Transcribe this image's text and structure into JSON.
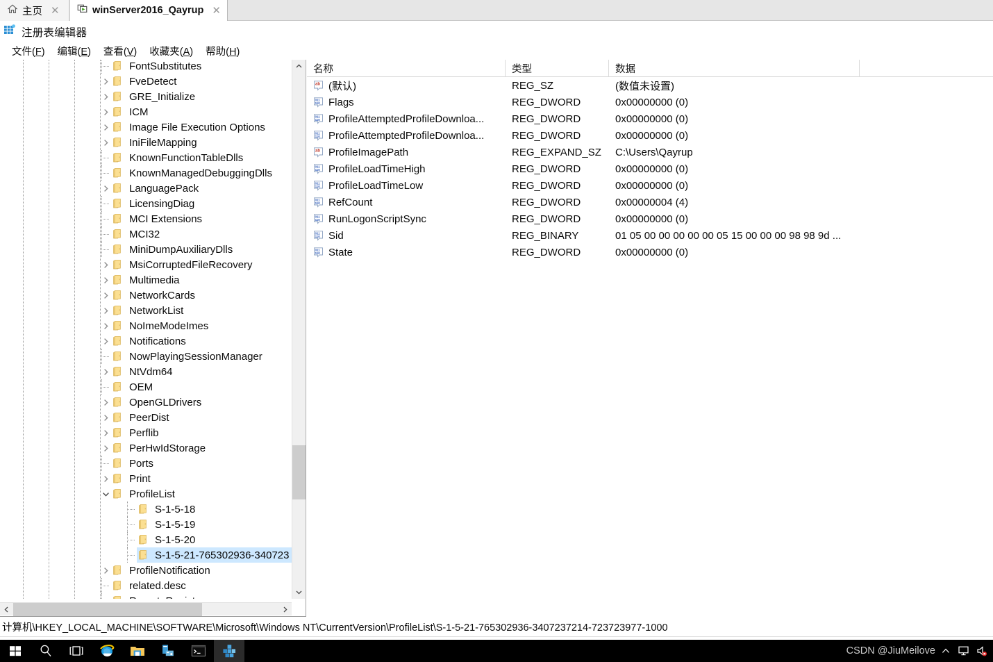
{
  "tabs": [
    {
      "label": "主页",
      "icon": "home-icon",
      "active": false
    },
    {
      "label": "winServer2016_Qayrup",
      "icon": "vm-running-icon",
      "active": true
    }
  ],
  "app": {
    "title": "注册表编辑器",
    "icon": "registry-editor-icon"
  },
  "menubar": [
    {
      "label": "文件(F)",
      "accel": "F"
    },
    {
      "label": "编辑(E)",
      "accel": "E"
    },
    {
      "label": "查看(V)",
      "accel": "V"
    },
    {
      "label": "收藏夹(A)",
      "accel": "A"
    },
    {
      "label": "帮助(H)",
      "accel": "H"
    }
  ],
  "tree": {
    "nodes": [
      {
        "label": "FontSubstitutes",
        "expandable": false,
        "expanded": false,
        "indent": 0,
        "selected": false
      },
      {
        "label": "FveDetect",
        "expandable": true,
        "expanded": false,
        "indent": 0,
        "selected": false
      },
      {
        "label": "GRE_Initialize",
        "expandable": true,
        "expanded": false,
        "indent": 0,
        "selected": false
      },
      {
        "label": "ICM",
        "expandable": true,
        "expanded": false,
        "indent": 0,
        "selected": false
      },
      {
        "label": "Image File Execution Options",
        "expandable": true,
        "expanded": false,
        "indent": 0,
        "selected": false
      },
      {
        "label": "IniFileMapping",
        "expandable": true,
        "expanded": false,
        "indent": 0,
        "selected": false
      },
      {
        "label": "KnownFunctionTableDlls",
        "expandable": false,
        "expanded": false,
        "indent": 0,
        "selected": false
      },
      {
        "label": "KnownManagedDebuggingDlls",
        "expandable": false,
        "expanded": false,
        "indent": 0,
        "selected": false
      },
      {
        "label": "LanguagePack",
        "expandable": true,
        "expanded": false,
        "indent": 0,
        "selected": false
      },
      {
        "label": "LicensingDiag",
        "expandable": false,
        "expanded": false,
        "indent": 0,
        "selected": false
      },
      {
        "label": "MCI Extensions",
        "expandable": false,
        "expanded": false,
        "indent": 0,
        "selected": false
      },
      {
        "label": "MCI32",
        "expandable": false,
        "expanded": false,
        "indent": 0,
        "selected": false
      },
      {
        "label": "MiniDumpAuxiliaryDlls",
        "expandable": false,
        "expanded": false,
        "indent": 0,
        "selected": false
      },
      {
        "label": "MsiCorruptedFileRecovery",
        "expandable": true,
        "expanded": false,
        "indent": 0,
        "selected": false
      },
      {
        "label": "Multimedia",
        "expandable": true,
        "expanded": false,
        "indent": 0,
        "selected": false
      },
      {
        "label": "NetworkCards",
        "expandable": true,
        "expanded": false,
        "indent": 0,
        "selected": false
      },
      {
        "label": "NetworkList",
        "expandable": true,
        "expanded": false,
        "indent": 0,
        "selected": false
      },
      {
        "label": "NoImeModeImes",
        "expandable": true,
        "expanded": false,
        "indent": 0,
        "selected": false
      },
      {
        "label": "Notifications",
        "expandable": true,
        "expanded": false,
        "indent": 0,
        "selected": false
      },
      {
        "label": "NowPlayingSessionManager",
        "expandable": false,
        "expanded": false,
        "indent": 0,
        "selected": false
      },
      {
        "label": "NtVdm64",
        "expandable": true,
        "expanded": false,
        "indent": 0,
        "selected": false
      },
      {
        "label": "OEM",
        "expandable": false,
        "expanded": false,
        "indent": 0,
        "selected": false
      },
      {
        "label": "OpenGLDrivers",
        "expandable": true,
        "expanded": false,
        "indent": 0,
        "selected": false
      },
      {
        "label": "PeerDist",
        "expandable": true,
        "expanded": false,
        "indent": 0,
        "selected": false
      },
      {
        "label": "Perflib",
        "expandable": true,
        "expanded": false,
        "indent": 0,
        "selected": false
      },
      {
        "label": "PerHwIdStorage",
        "expandable": true,
        "expanded": false,
        "indent": 0,
        "selected": false
      },
      {
        "label": "Ports",
        "expandable": false,
        "expanded": false,
        "indent": 0,
        "selected": false
      },
      {
        "label": "Print",
        "expandable": true,
        "expanded": false,
        "indent": 0,
        "selected": false
      },
      {
        "label": "ProfileList",
        "expandable": true,
        "expanded": true,
        "indent": 0,
        "selected": false
      },
      {
        "label": "S-1-5-18",
        "expandable": false,
        "expanded": false,
        "indent": 1,
        "selected": false
      },
      {
        "label": "S-1-5-19",
        "expandable": false,
        "expanded": false,
        "indent": 1,
        "selected": false
      },
      {
        "label": "S-1-5-20",
        "expandable": false,
        "expanded": false,
        "indent": 1,
        "selected": false
      },
      {
        "label": "S-1-5-21-765302936-340723",
        "expandable": false,
        "expanded": false,
        "indent": 1,
        "selected": true
      },
      {
        "label": "ProfileNotification",
        "expandable": true,
        "expanded": false,
        "indent": 0,
        "selected": false
      },
      {
        "label": "related.desc",
        "expandable": false,
        "expanded": false,
        "indent": 0,
        "selected": false
      },
      {
        "label": "RemoteRegistry",
        "expandable": false,
        "expanded": false,
        "indent": 0,
        "selected": false
      }
    ]
  },
  "values": {
    "columns": [
      {
        "label": "名称",
        "key": "name"
      },
      {
        "label": "类型",
        "key": "type"
      },
      {
        "label": "数据",
        "key": "data"
      }
    ],
    "rows": [
      {
        "icon": "string-value-icon",
        "name": "(默认)",
        "type": "REG_SZ",
        "data": "(数值未设置)"
      },
      {
        "icon": "binary-value-icon",
        "name": "Flags",
        "type": "REG_DWORD",
        "data": "0x00000000 (0)"
      },
      {
        "icon": "binary-value-icon",
        "name": "ProfileAttemptedProfileDownloa...",
        "type": "REG_DWORD",
        "data": "0x00000000 (0)"
      },
      {
        "icon": "binary-value-icon",
        "name": "ProfileAttemptedProfileDownloa...",
        "type": "REG_DWORD",
        "data": "0x00000000 (0)"
      },
      {
        "icon": "string-value-icon",
        "name": "ProfileImagePath",
        "type": "REG_EXPAND_SZ",
        "data": "C:\\Users\\Qayrup"
      },
      {
        "icon": "binary-value-icon",
        "name": "ProfileLoadTimeHigh",
        "type": "REG_DWORD",
        "data": "0x00000000 (0)"
      },
      {
        "icon": "binary-value-icon",
        "name": "ProfileLoadTimeLow",
        "type": "REG_DWORD",
        "data": "0x00000000 (0)"
      },
      {
        "icon": "binary-value-icon",
        "name": "RefCount",
        "type": "REG_DWORD",
        "data": "0x00000004 (4)"
      },
      {
        "icon": "binary-value-icon",
        "name": "RunLogonScriptSync",
        "type": "REG_DWORD",
        "data": "0x00000000 (0)"
      },
      {
        "icon": "binary-value-icon",
        "name": "Sid",
        "type": "REG_BINARY",
        "data": "01 05 00 00 00 00 00 05 15 00 00 00 98 98 9d ..."
      },
      {
        "icon": "binary-value-icon",
        "name": "State",
        "type": "REG_DWORD",
        "data": "0x00000000 (0)"
      }
    ]
  },
  "statusbar": {
    "path": "计算机\\HKEY_LOCAL_MACHINE\\SOFTWARE\\Microsoft\\Windows NT\\CurrentVersion\\ProfileList\\S-1-5-21-765302936-3407237214-723723977-1000"
  },
  "taskbar": {
    "items": [
      {
        "icon": "windows-start-icon",
        "active": false
      },
      {
        "icon": "search-icon",
        "active": false
      },
      {
        "icon": "task-view-icon",
        "active": false
      },
      {
        "icon": "internet-explorer-icon",
        "active": false
      },
      {
        "icon": "file-explorer-icon",
        "active": false
      },
      {
        "icon": "server-manager-icon",
        "active": false
      },
      {
        "icon": "command-prompt-icon",
        "active": false
      },
      {
        "icon": "registry-editor-icon",
        "active": true
      }
    ],
    "watermark": "CSDN @JiuMeilove",
    "tray": [
      {
        "icon": "chevron-up-icon"
      },
      {
        "icon": "network-monitor-icon"
      },
      {
        "icon": "volume-icon"
      }
    ]
  },
  "colors": {
    "selection": "#cde8ff",
    "folder": "#f8d775",
    "taskbar": "#000000",
    "string_icon": "#c0392b",
    "binary_icon": "#2e5bb8"
  }
}
